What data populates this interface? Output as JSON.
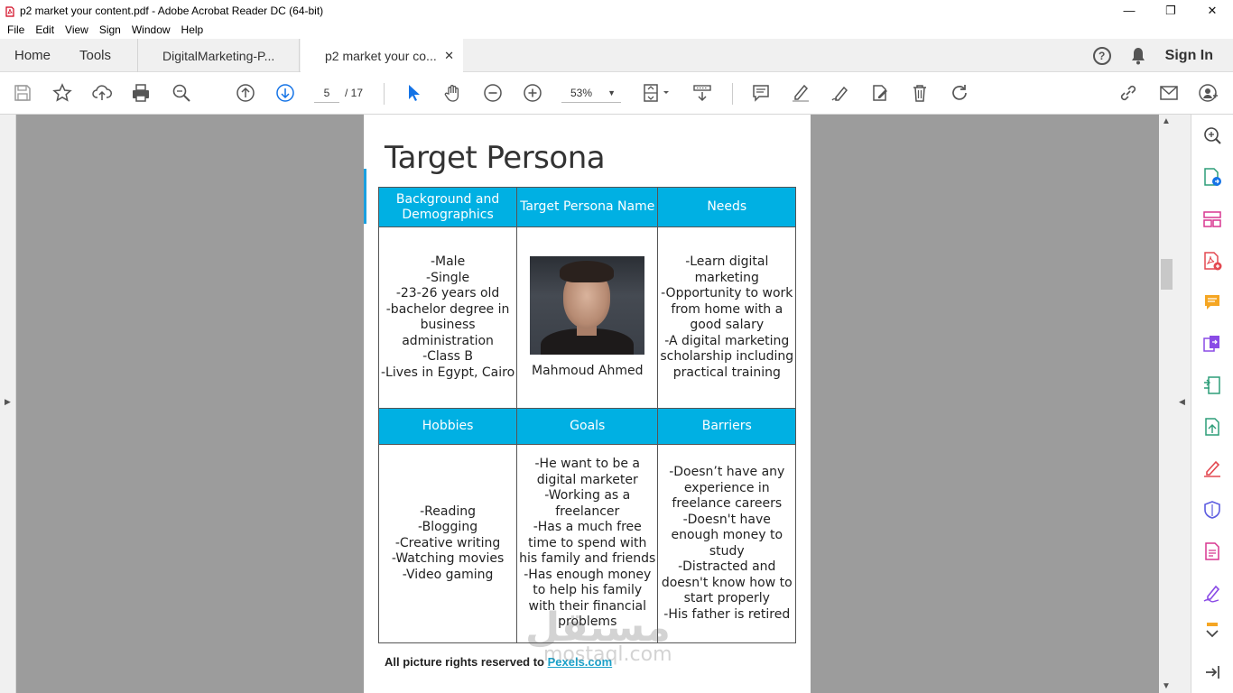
{
  "window": {
    "title": "p2 market your content.pdf - Adobe Acrobat Reader DC (64-bit)",
    "minimize": "—",
    "restore": "❐",
    "close": "✕"
  },
  "menu": [
    "File",
    "Edit",
    "View",
    "Sign",
    "Window",
    "Help"
  ],
  "tabs": {
    "home": "Home",
    "tools": "Tools",
    "doc1": "DigitalMarketing-P...",
    "doc2": "p2 market your co...",
    "doc2_close": "✕"
  },
  "header_right": {
    "help": "?",
    "signin": "Sign In"
  },
  "toolbar": {
    "page_current": "5",
    "page_total": "/  17",
    "zoom": "53%",
    "zoom_caret": "▼"
  },
  "document": {
    "title": "Target Persona",
    "headers_row1": [
      "Background and Demographics",
      "Target Persona Name",
      "Needs"
    ],
    "headers_row2": [
      "Hobbies",
      "Goals",
      "Barriers"
    ],
    "background": [
      "-Male",
      "-Single",
      "-23-26 years old",
      "-bachelor degree in",
      "business",
      "administration",
      "-Class B",
      "-Lives in Egypt, Cairo"
    ],
    "persona_name": "Mahmoud Ahmed",
    "needs": [
      "-Learn digital",
      "marketing",
      "-Opportunity to work",
      "from home with a",
      "good salary",
      "-A digital marketing",
      "scholarship including",
      "practical training"
    ],
    "hobbies": [
      "-Reading",
      "-Blogging",
      "-Creative writing",
      "-Watching movies",
      "-Video gaming"
    ],
    "goals": [
      "-He want to be a",
      "digital marketer",
      "-Working as a",
      "freelancer",
      "-Has a much free",
      "time to spend with",
      "his family and friends",
      "-Has enough money",
      "to help his family",
      "with their financial",
      "problems"
    ],
    "barriers": [
      "-Doesn’t have any",
      "experience in",
      "freelance careers",
      "-Doesn't have",
      "enough money to",
      "study",
      "-Distracted and",
      "doesn't know how to",
      "start properly",
      "-His father is retired"
    ],
    "credit_text": "All picture rights reserved to ",
    "credit_link": "Pexels.com"
  },
  "watermark": {
    "arabic": "مستقل",
    "latin": "mostaql.com"
  },
  "colors": {
    "header_cell": "#00b0e3",
    "viewer_bg": "#9c9c9c",
    "accent_blue": "#1473e6",
    "right_panel_icons": [
      "#1473e6",
      "#e34850",
      "#d83790",
      "#f5a623",
      "#8a4be6",
      "#2d9d78"
    ]
  },
  "icons": {
    "app": "acrobat-icon",
    "toolbar": [
      "save-icon",
      "star-icon",
      "upload-icon",
      "print-icon",
      "search-icon",
      "page-up-icon",
      "page-down-icon",
      "zoom-out-icon",
      "zoom-in-icon",
      "select-arrow-icon",
      "hand-icon",
      "fit-page-icon",
      "scroll-icon",
      "comment-icon",
      "highlight-icon",
      "sign-icon",
      "edit-icon",
      "delete-icon",
      "rotate-icon",
      "link-icon",
      "email-icon",
      "share-user-icon"
    ],
    "right_panel": [
      "zoom-search-icon",
      "export-pdf-icon",
      "organize-pages-icon",
      "create-pdf-icon",
      "comment-icon",
      "combine-icon",
      "compress-icon",
      "convert-icon",
      "fill-sign-icon",
      "protect-icon",
      "edit-pdf-icon",
      "request-sign-icon",
      "expand-icon",
      "collapse-panel-icon"
    ]
  }
}
